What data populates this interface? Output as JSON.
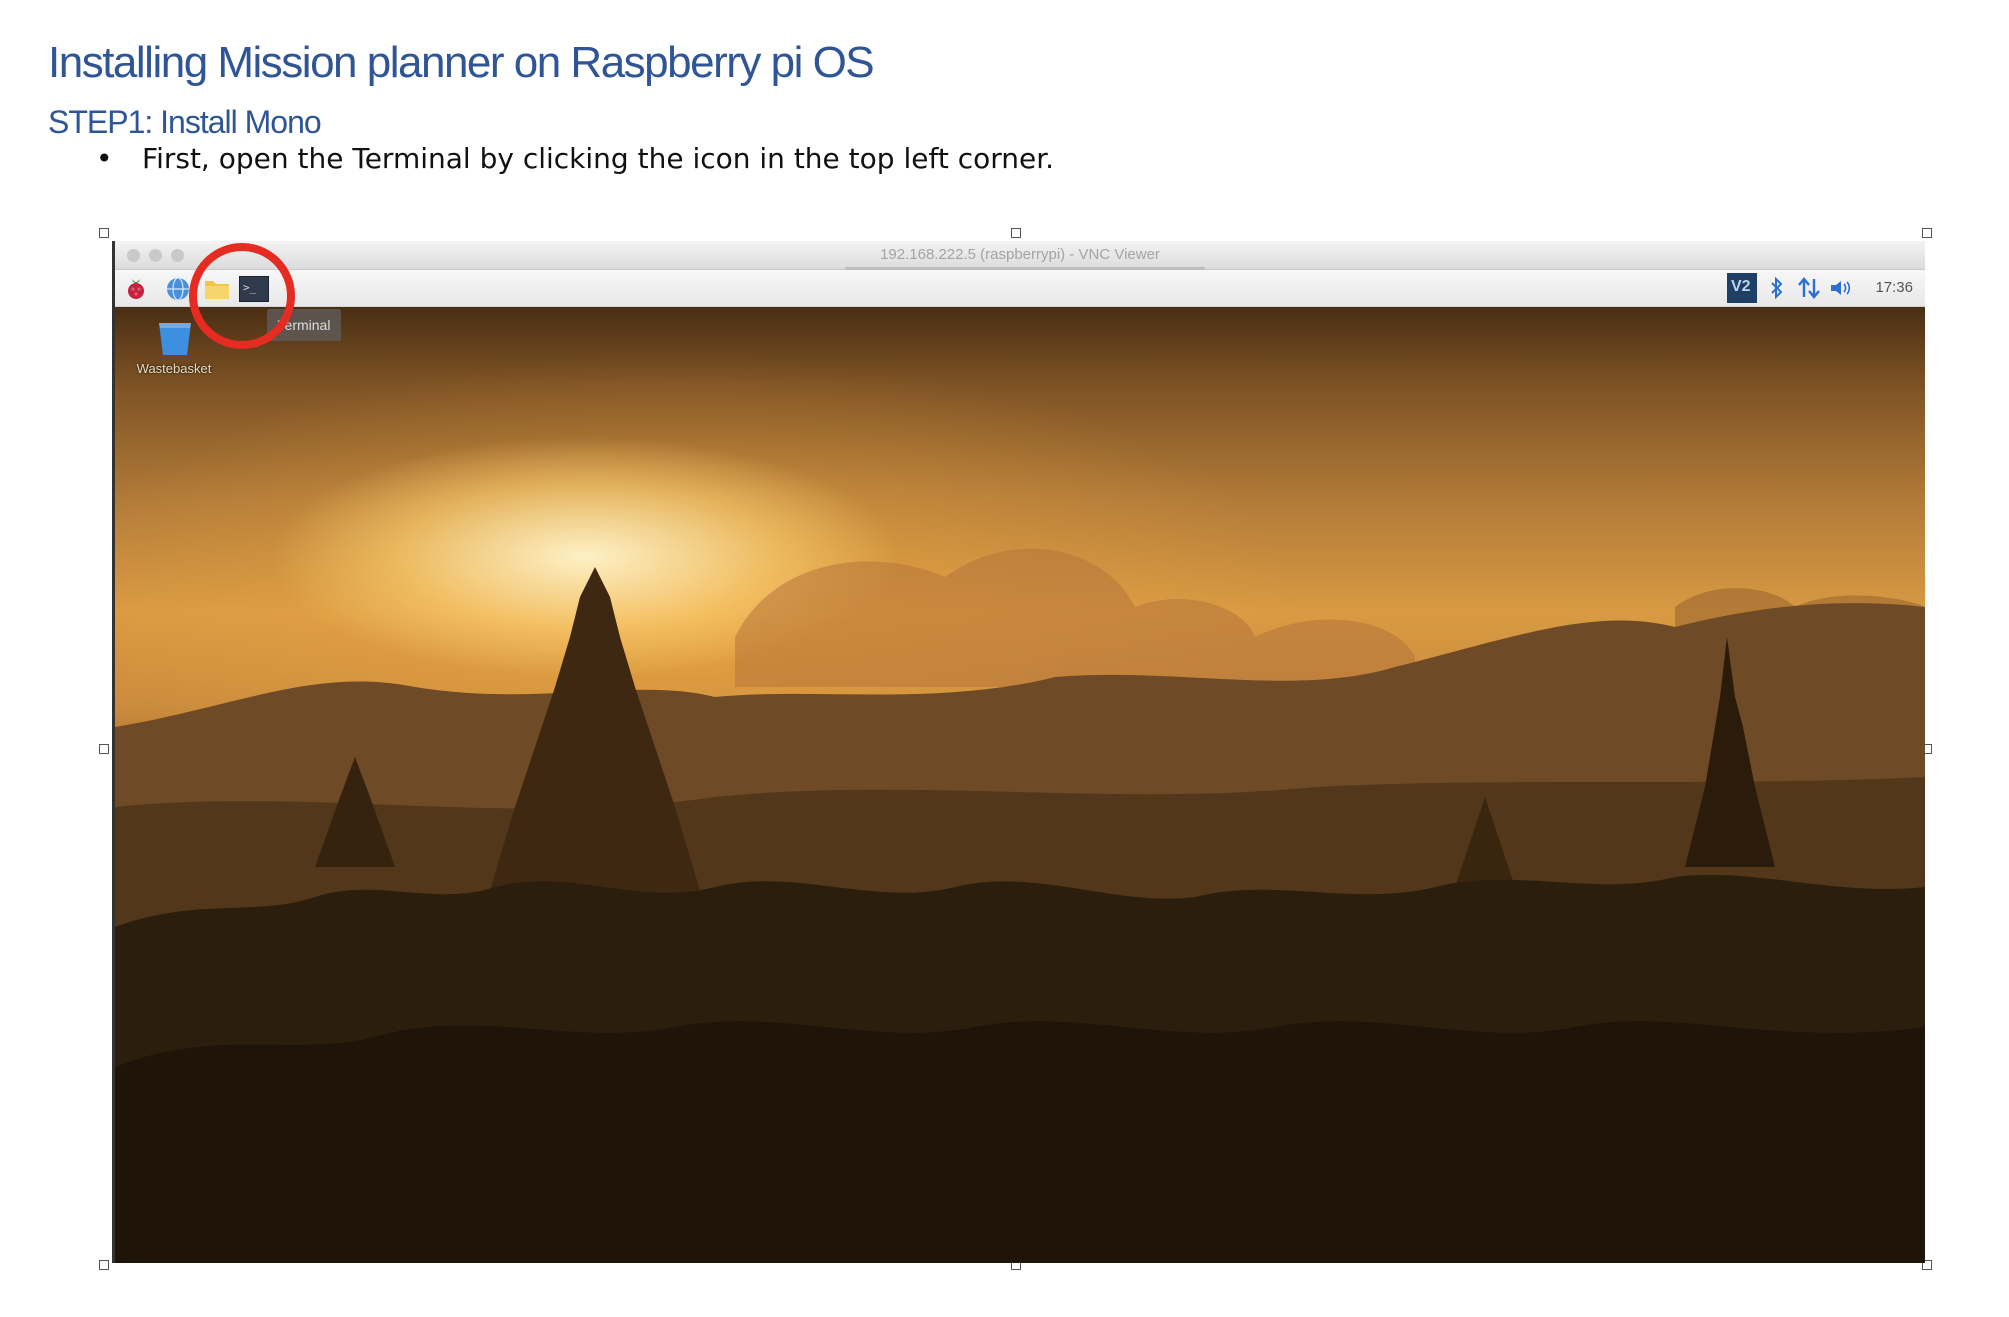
{
  "document": {
    "title": "Installing Mission planner on Raspberry pi OS",
    "subtitle": "STEP1: Install Mono",
    "bullet_marker": "•",
    "bullet_text": "First, open the Terminal by clicking the icon in the top left corner."
  },
  "screenshot": {
    "window_title": "192.168.222.5 (raspberrypi) - VNC Viewer",
    "tooltip": "Terminal",
    "desktop_icon_label": "Wastebasket",
    "clock": "17:36",
    "tray_badge": "V2",
    "terminal_glyph": ">_",
    "annotation_color": "#e52b22"
  }
}
